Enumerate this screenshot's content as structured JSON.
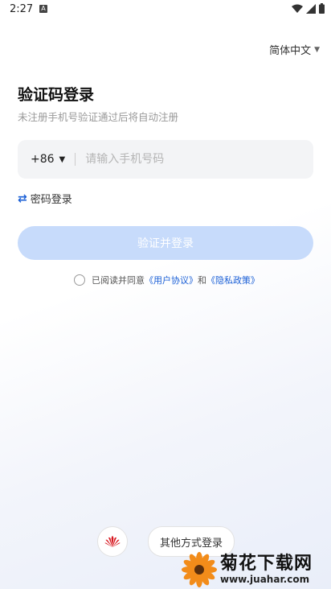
{
  "status_bar": {
    "time": "2:27",
    "a_badge": "A"
  },
  "language": {
    "label": "简体中文"
  },
  "login": {
    "title": "验证码登录",
    "subtitle": "未注册手机号验证通过后将自动注册",
    "country_code": "+86",
    "phone_placeholder": "请输入手机号码",
    "password_login": "密码登录",
    "submit": "验证并登录"
  },
  "agreement": {
    "prefix": "已阅读并同意",
    "user_agreement": "《用户协议》",
    "and": "和",
    "privacy_policy": "《隐私政策》"
  },
  "other_login": {
    "label": "其他方式登录"
  },
  "watermark": {
    "title": "菊花下载网",
    "url": "www.juahar.com"
  },
  "colors": {
    "accent": "#1a5fd6",
    "button_disabled": "#c7dbfb",
    "huawei_red": "#d7171f"
  }
}
